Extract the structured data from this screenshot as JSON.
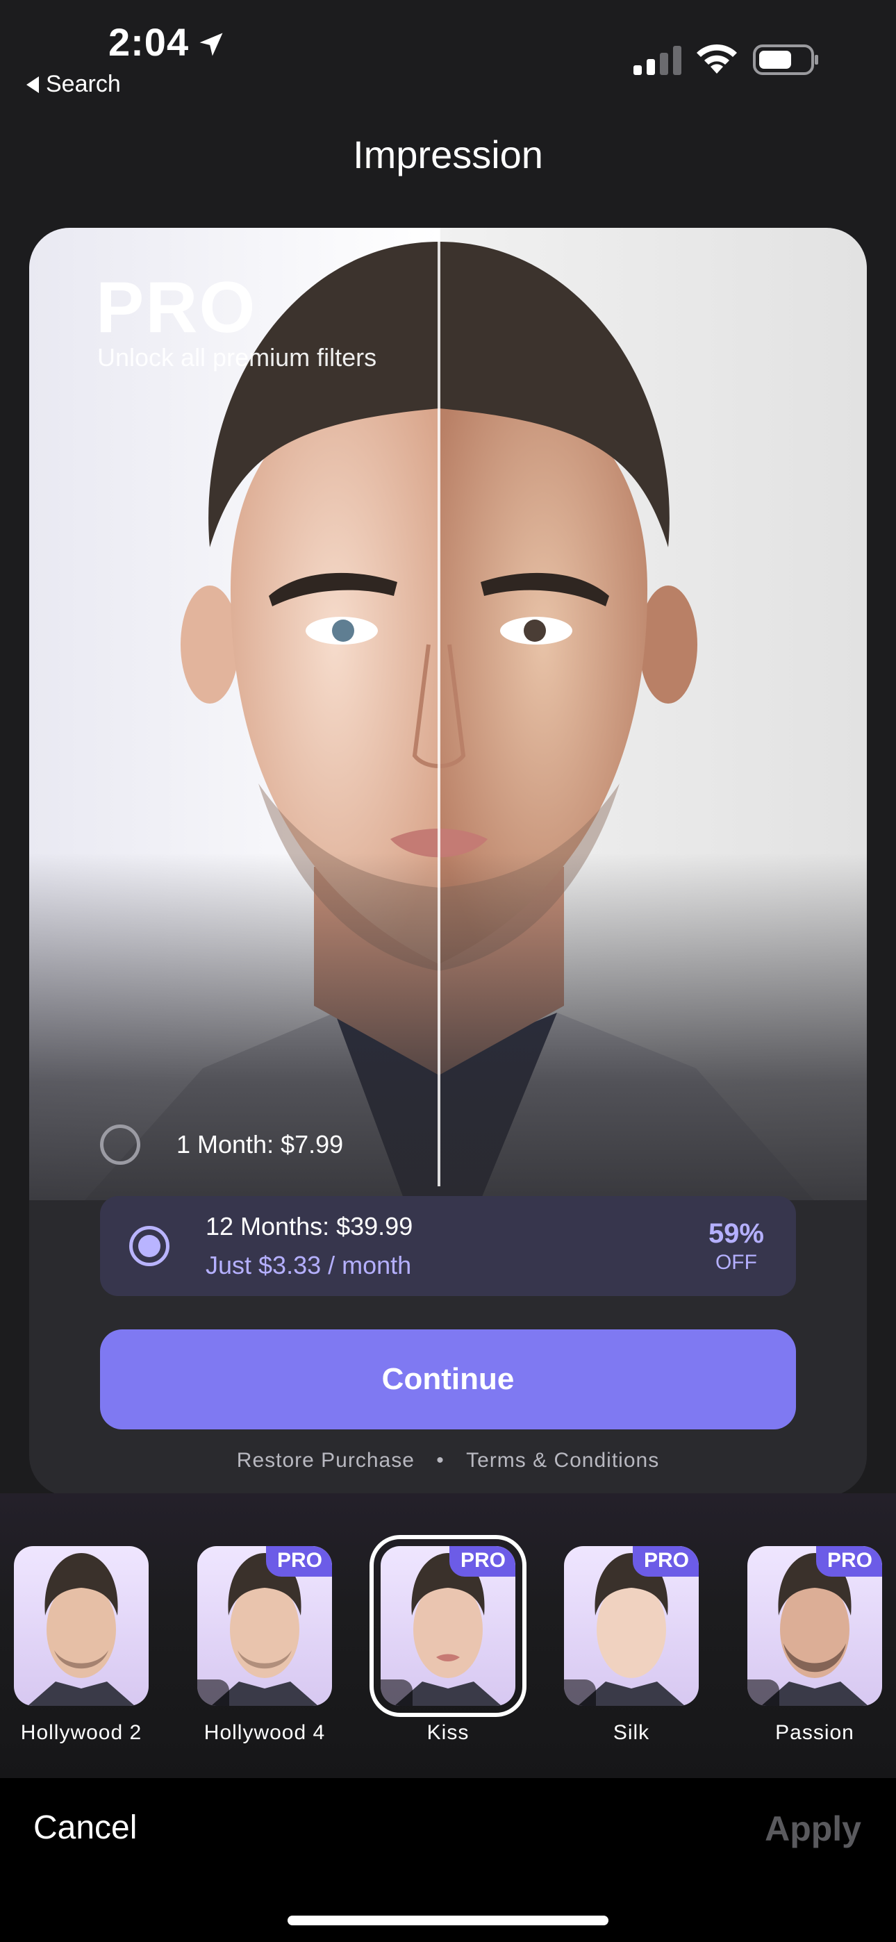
{
  "status": {
    "time": "2:04",
    "back_label": "Search"
  },
  "nav": {
    "title": "Impression"
  },
  "paywall": {
    "title": "PRO",
    "subtitle": "Unlock all premium filters",
    "plans": [
      {
        "label": "1 Month: $7.99",
        "selected": false
      },
      {
        "label": "12 Months: $39.99",
        "sublabel": "Just $3.33 / month",
        "discount": "59%",
        "discount_suffix": "OFF",
        "selected": true
      }
    ],
    "continue_label": "Continue",
    "restore_label": "Restore Purchase",
    "separator": "•",
    "terms_label": "Terms & Conditions"
  },
  "filters": [
    {
      "name": "Hollywood 2",
      "pro": false,
      "selected": false
    },
    {
      "name": "Hollywood 4",
      "pro": true,
      "badge": "PRO",
      "selected": false
    },
    {
      "name": "Kiss",
      "pro": true,
      "badge": "PRO",
      "selected": true
    },
    {
      "name": "Silk",
      "pro": true,
      "badge": "PRO",
      "selected": false
    },
    {
      "name": "Passion",
      "pro": true,
      "badge": "PRO",
      "selected": false
    }
  ],
  "bottom": {
    "cancel_label": "Cancel",
    "apply_label": "Apply"
  },
  "colors": {
    "accent": "#7f79f2",
    "accent_light": "#b5b0ff",
    "pro_badge": "#6c5ce7",
    "background": "#1c1c1e"
  }
}
